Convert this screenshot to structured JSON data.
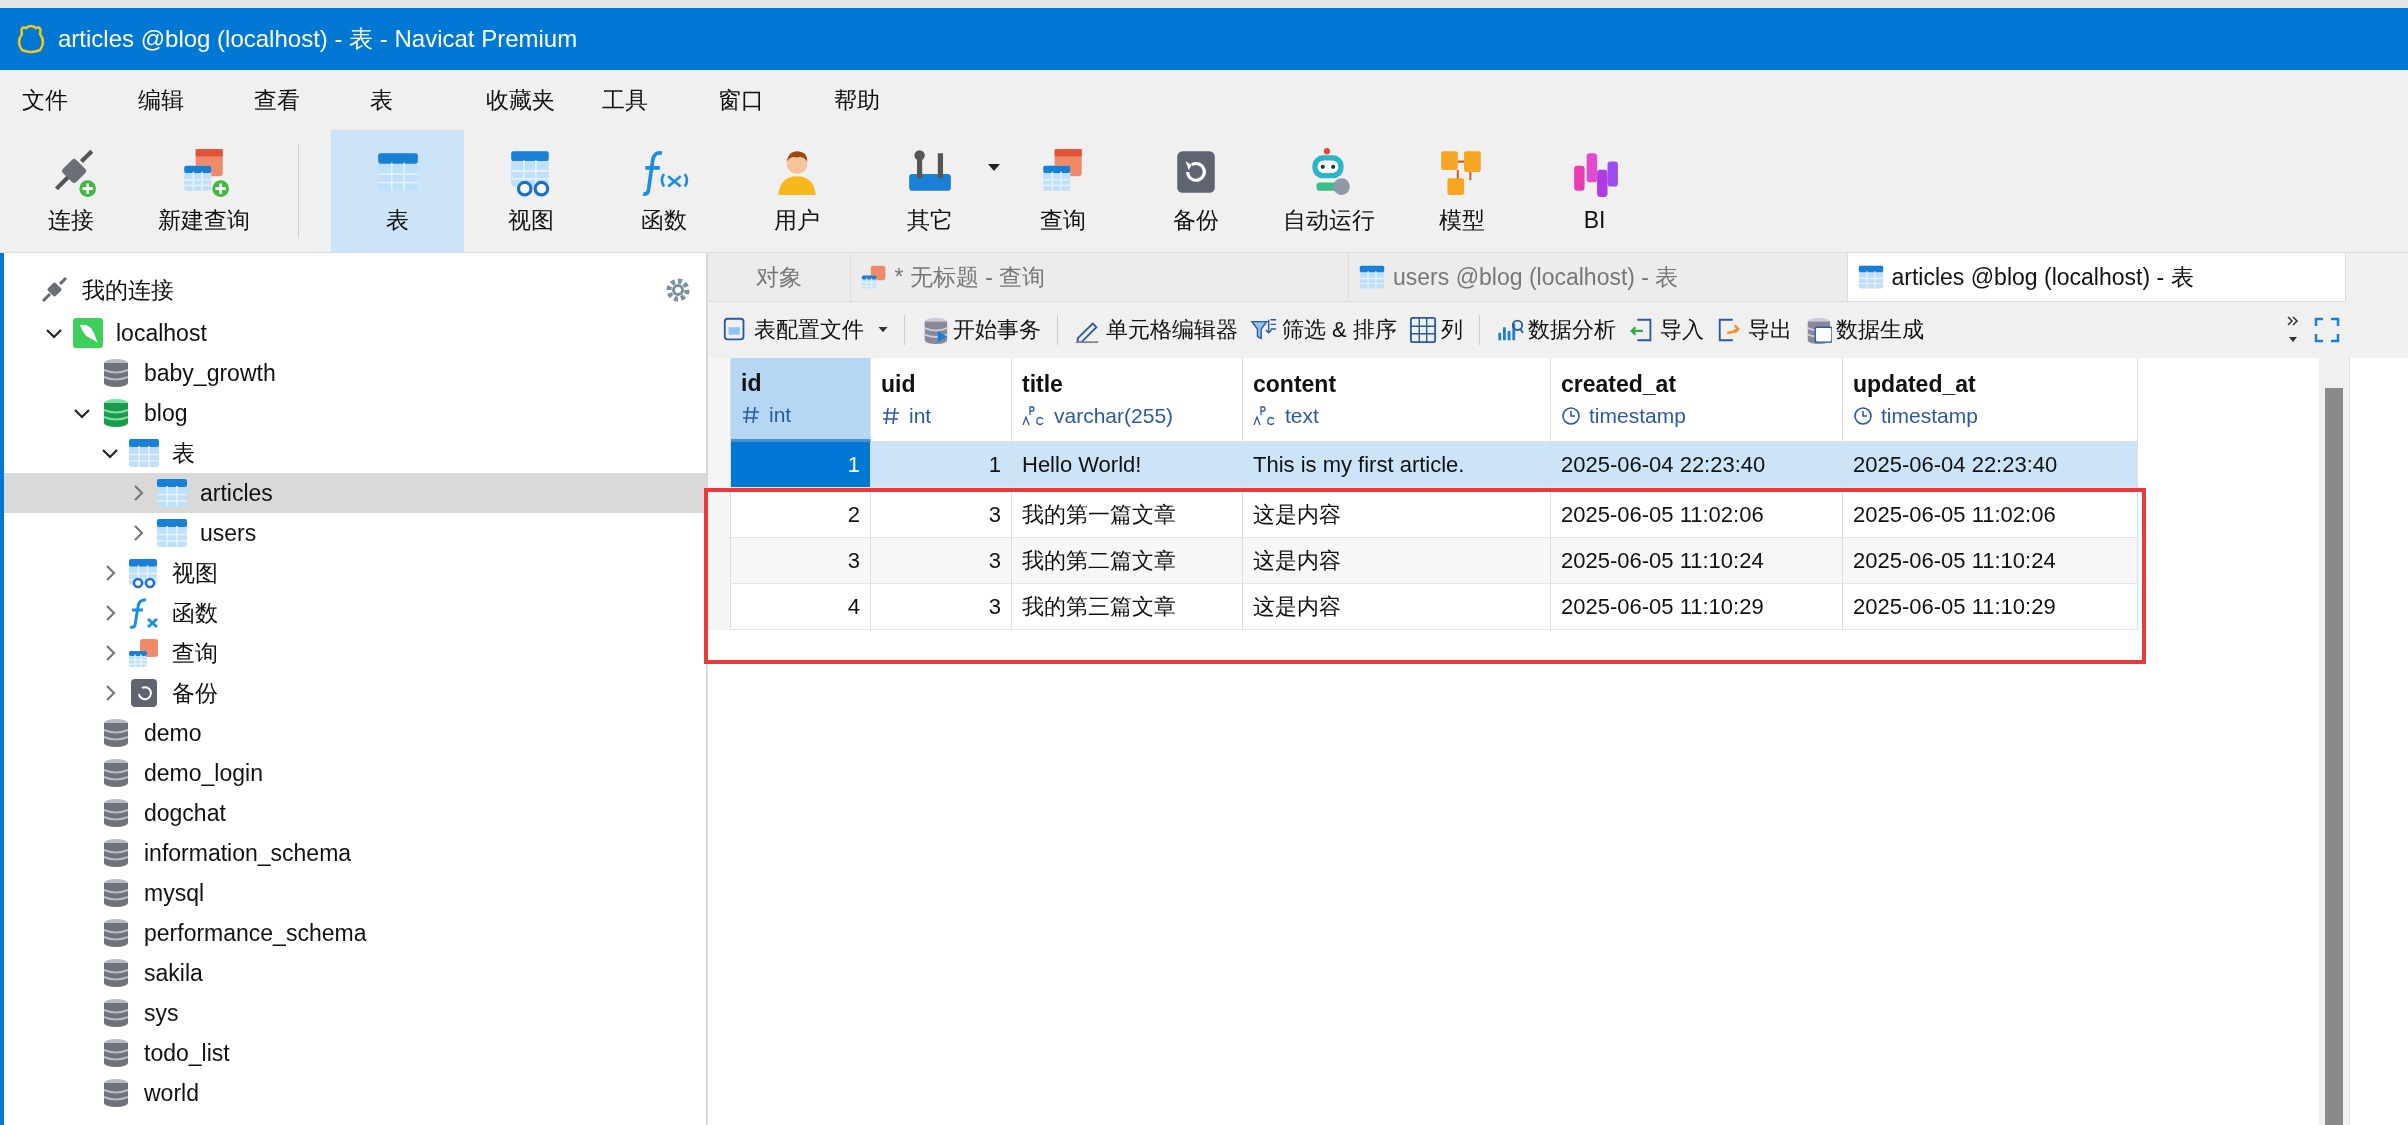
{
  "window": {
    "title": "articles @blog (localhost) - 表 - Navicat Premium"
  },
  "menu": [
    "文件",
    "编辑",
    "查看",
    "表",
    "收藏夹",
    "工具",
    "窗口",
    "帮助"
  ],
  "toolbar": [
    {
      "label": "连接",
      "kind": "connect",
      "selected": false
    },
    {
      "label": "新建查询",
      "kind": "new-query",
      "selected": false
    },
    {
      "label": "表",
      "kind": "table",
      "selected": true,
      "group_start": true
    },
    {
      "label": "视图",
      "kind": "view",
      "selected": false
    },
    {
      "label": "函数",
      "kind": "function",
      "selected": false
    },
    {
      "label": "用户",
      "kind": "user",
      "selected": false
    },
    {
      "label": "其它",
      "kind": "other",
      "selected": false,
      "dropdown": true
    },
    {
      "label": "查询",
      "kind": "query",
      "selected": false
    },
    {
      "label": "备份",
      "kind": "backup",
      "selected": false
    },
    {
      "label": "自动运行",
      "kind": "robot",
      "selected": false
    },
    {
      "label": "模型",
      "kind": "model",
      "selected": false
    },
    {
      "label": "BI",
      "kind": "bi",
      "selected": false
    }
  ],
  "sidebar": {
    "title": "我的连接",
    "tree": [
      {
        "label": "localhost",
        "kind": "server",
        "expanded": true,
        "selected": false,
        "children": [
          {
            "label": "baby_growth",
            "kind": "database",
            "selected": false
          },
          {
            "label": "blog",
            "kind": "database-open",
            "expanded": true,
            "selected": false,
            "children": [
              {
                "label": "表",
                "kind": "tables",
                "expanded": true,
                "selected": false,
                "children": [
                  {
                    "label": "articles",
                    "kind": "table",
                    "expanded": false,
                    "selected": true
                  },
                  {
                    "label": "users",
                    "kind": "table",
                    "expanded": false,
                    "selected": false
                  }
                ]
              },
              {
                "label": "视图",
                "kind": "views",
                "expanded": false,
                "selected": false
              },
              {
                "label": "函数",
                "kind": "functions",
                "expanded": false,
                "selected": false
              },
              {
                "label": "查询",
                "kind": "queries",
                "expanded": false,
                "selected": false
              },
              {
                "label": "备份",
                "kind": "backups",
                "expanded": false,
                "selected": false
              }
            ]
          },
          {
            "label": "demo",
            "kind": "database",
            "selected": false
          },
          {
            "label": "demo_login",
            "kind": "database",
            "selected": false
          },
          {
            "label": "dogchat",
            "kind": "database",
            "selected": false
          },
          {
            "label": "information_schema",
            "kind": "database",
            "selected": false
          },
          {
            "label": "mysql",
            "kind": "database",
            "selected": false
          },
          {
            "label": "performance_schema",
            "kind": "database",
            "selected": false
          },
          {
            "label": "sakila",
            "kind": "database",
            "selected": false
          },
          {
            "label": "sys",
            "kind": "database",
            "selected": false
          },
          {
            "label": "todo_list",
            "kind": "database",
            "selected": false
          },
          {
            "label": "world",
            "kind": "database",
            "selected": false
          }
        ]
      }
    ]
  },
  "tabs": [
    {
      "label": "对象",
      "kind": "objects",
      "selected": false
    },
    {
      "label": "* 无标题 - 查询",
      "kind": "query",
      "selected": false
    },
    {
      "label": "users @blog (localhost) - 表",
      "kind": "table",
      "selected": false
    },
    {
      "label": "articles @blog (localhost) - 表",
      "kind": "table",
      "selected": true
    }
  ],
  "tools": [
    {
      "label": "表配置文件",
      "kind": "profile",
      "dropdown": true
    },
    {
      "label": "开始事务",
      "kind": "transaction",
      "group_start": true
    },
    {
      "label": "单元格编辑器",
      "kind": "editor",
      "group_start": true
    },
    {
      "label": "筛选 & 排序",
      "kind": "filter"
    },
    {
      "label": "列",
      "kind": "columns"
    },
    {
      "label": "数据分析",
      "kind": "analysis",
      "group_start": true
    },
    {
      "label": "导入",
      "kind": "import"
    },
    {
      "label": "导出",
      "kind": "export"
    },
    {
      "label": "数据生成",
      "kind": "generate"
    }
  ],
  "grid": {
    "columns": [
      {
        "name": "id",
        "type": "int",
        "kind": "number",
        "selected": true
      },
      {
        "name": "uid",
        "type": "int",
        "kind": "number",
        "selected": false
      },
      {
        "name": "title",
        "type": "varchar(255)",
        "kind": "text",
        "selected": false
      },
      {
        "name": "content",
        "type": "text",
        "kind": "text",
        "selected": false
      },
      {
        "name": "created_at",
        "type": "timestamp",
        "kind": "time",
        "selected": false
      },
      {
        "name": "updated_at",
        "type": "timestamp",
        "kind": "time",
        "selected": false
      }
    ],
    "rows": [
      {
        "selected": true,
        "outlined": false,
        "cells": [
          "1",
          "1",
          "Hello World!",
          "This is my first article.",
          "2025-06-04 22:23:40",
          "2025-06-04 22:23:40"
        ]
      },
      {
        "selected": false,
        "outlined": true,
        "cells": [
          "2",
          "3",
          "我的第一篇文章",
          "这是内容",
          "2025-06-05 11:02:06",
          "2025-06-05 11:02:06"
        ]
      },
      {
        "selected": false,
        "outlined": true,
        "cells": [
          "3",
          "3",
          "我的第二篇文章",
          "这是内容",
          "2025-06-05 11:10:24",
          "2025-06-05 11:10:24"
        ]
      },
      {
        "selected": false,
        "outlined": true,
        "cells": [
          "4",
          "3",
          "我的第三篇文章",
          "这是内容",
          "2025-06-05 11:10:29",
          "2025-06-05 11:10:29"
        ]
      }
    ]
  }
}
